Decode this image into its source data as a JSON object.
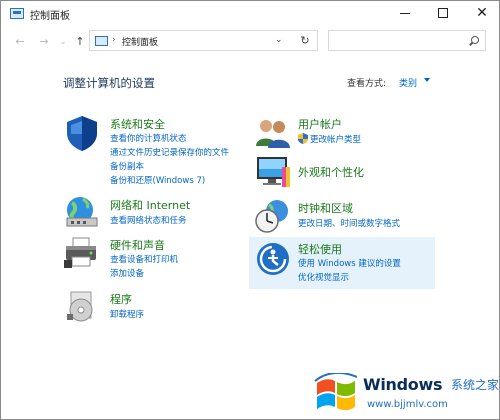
{
  "window": {
    "title": "控制面板"
  },
  "address": {
    "path": "控制面板",
    "separator": "›"
  },
  "search": {
    "placeholder": ""
  },
  "header": {
    "title": "调整计算机的设置",
    "view_by_label": "查看方式:",
    "view_by_value": "类别"
  },
  "categories": [
    {
      "title": "系统和安全",
      "links": [
        "查看你的计算机状态",
        "通过文件历史记录保存你的文件",
        "备份副本",
        "备份和还原(Windows 7)"
      ]
    },
    {
      "title": "网络和 Internet",
      "links": [
        "查看网络状态和任务"
      ]
    },
    {
      "title": "硬件和声音",
      "links": [
        "查看设备和打印机",
        "添加设备"
      ]
    },
    {
      "title": "程序",
      "links": [
        "卸载程序"
      ]
    },
    {
      "title": "用户帐户",
      "links": [
        "更改帐户类型"
      ]
    },
    {
      "title": "外观和个性化",
      "links": []
    },
    {
      "title": "时钟和区域",
      "links": [
        "更改日期、时间或数字格式"
      ]
    },
    {
      "title": "轻松使用",
      "links": [
        "使用 Windows 建议的设置",
        "优化视觉显示"
      ]
    }
  ],
  "watermark": {
    "brand": "Windows",
    "cn": "系统之家",
    "url": "www.bjjmlv.com"
  },
  "colors": {
    "link": "#0066cc",
    "category_title": "#1a7a1a",
    "heading": "#1e395b",
    "hover": "#e5f1fb"
  }
}
